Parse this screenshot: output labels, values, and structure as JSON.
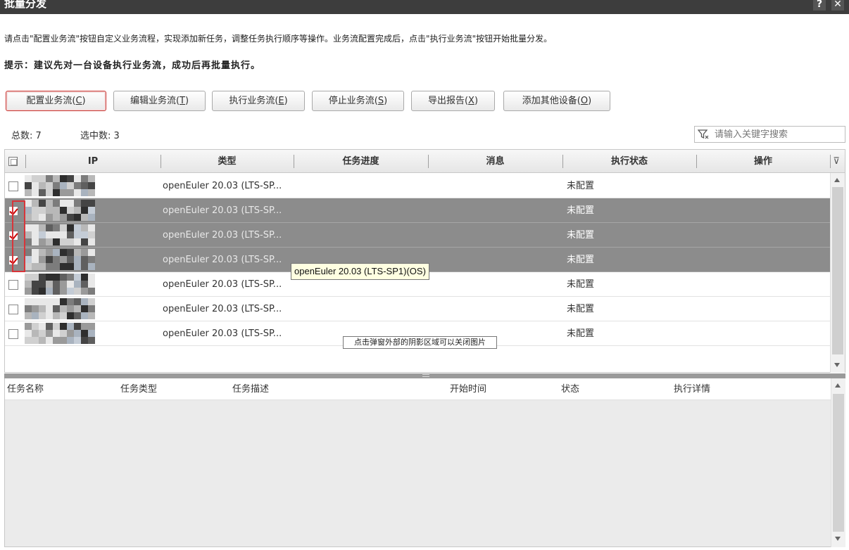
{
  "window": {
    "title": "批量分发",
    "help": "?",
    "close": "✕"
  },
  "intro": "请点击\"配置业务流\"按钮自定义业务流程，实现添加新任务，调整任务执行顺序等操作。业务流配置完成后，点击\"执行业务流\"按钮开始批量分发。",
  "tip": "提示：建议先对一台设备执行业务流，成功后再批量执行。",
  "toolbar": [
    {
      "text": "配置业务流(",
      "key": "C",
      "end": ")"
    },
    {
      "text": "编辑业务流(",
      "key": "T",
      "end": ")"
    },
    {
      "text": "执行业务流(",
      "key": "E",
      "end": ")"
    },
    {
      "text": "停止业务流(",
      "key": "S",
      "end": ")"
    },
    {
      "text": "导出报告(",
      "key": "X",
      "end": ")"
    },
    {
      "text": "添加其他设备(",
      "key": "O",
      "end": ")"
    }
  ],
  "summary": {
    "total_label": "总数: ",
    "total": "7",
    "selected_label": "选中数: ",
    "selected": "3"
  },
  "search": {
    "placeholder": "请输入关键字搜索"
  },
  "columns": {
    "ip": "IP",
    "type": "类型",
    "progress": "任务进度",
    "message": "消息",
    "exec_state": "执行状态",
    "action": "操作"
  },
  "rows": [
    {
      "type": "openEuler 20.03 (LTS-SP...",
      "status": "未配置",
      "checked": false
    },
    {
      "type": "openEuler 20.03 (LTS-SP...",
      "status": "未配置",
      "checked": true
    },
    {
      "type": "openEuler 20.03 (LTS-SP...",
      "status": "未配置",
      "checked": true
    },
    {
      "type": "openEuler 20.03 (LTS-SP...",
      "status": "未配置",
      "checked": true
    },
    {
      "type": "openEuler 20.03 (LTS-SP...",
      "status": "未配置",
      "checked": false
    },
    {
      "type": "openEuler 20.03 (LTS-SP...",
      "status": "未配置",
      "checked": false
    },
    {
      "type": "openEuler 20.03 (LTS-SP...",
      "status": "未配置",
      "checked": false
    }
  ],
  "tooltip": "openEuler 20.03 (LTS-SP1)(OS)",
  "toast": "点击弹窗外部的阴影区域可以关闭图片",
  "task_columns": {
    "name": "任务名称",
    "type": "任务类型",
    "desc": "任务描述",
    "start": "开始时间",
    "status": "状态",
    "detail": "执行详情"
  },
  "colors": {
    "titlebar": "#3d3d3d",
    "selected_row": "#8c8c8c",
    "check_mark": "#cc0000",
    "tooltip_bg": "#ffffe1"
  }
}
